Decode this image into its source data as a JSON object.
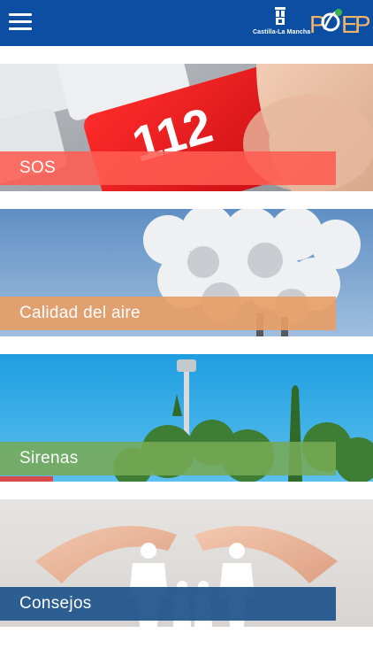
{
  "header": {
    "menu_icon": "hamburger-menu-icon",
    "government_logo_text": "Castilla-La Mancha",
    "app_logo_text": "PLEIEP",
    "background_color": "#0b4ea2"
  },
  "cards": [
    {
      "label": "SOS",
      "image": "keyboard-112-key-photo",
      "overlay_color": "#ff5c52"
    },
    {
      "label": "Calidad del aire",
      "image": "industrial-smoke-clouds-photo",
      "overlay_color": "#e99d64"
    },
    {
      "label": "Sirenas",
      "image": "siren-tower-trees-photo",
      "overlay_color": "#76aa55"
    },
    {
      "label": "Consejos",
      "image": "hands-protecting-family-photo",
      "overlay_color": "#1e548c"
    }
  ]
}
